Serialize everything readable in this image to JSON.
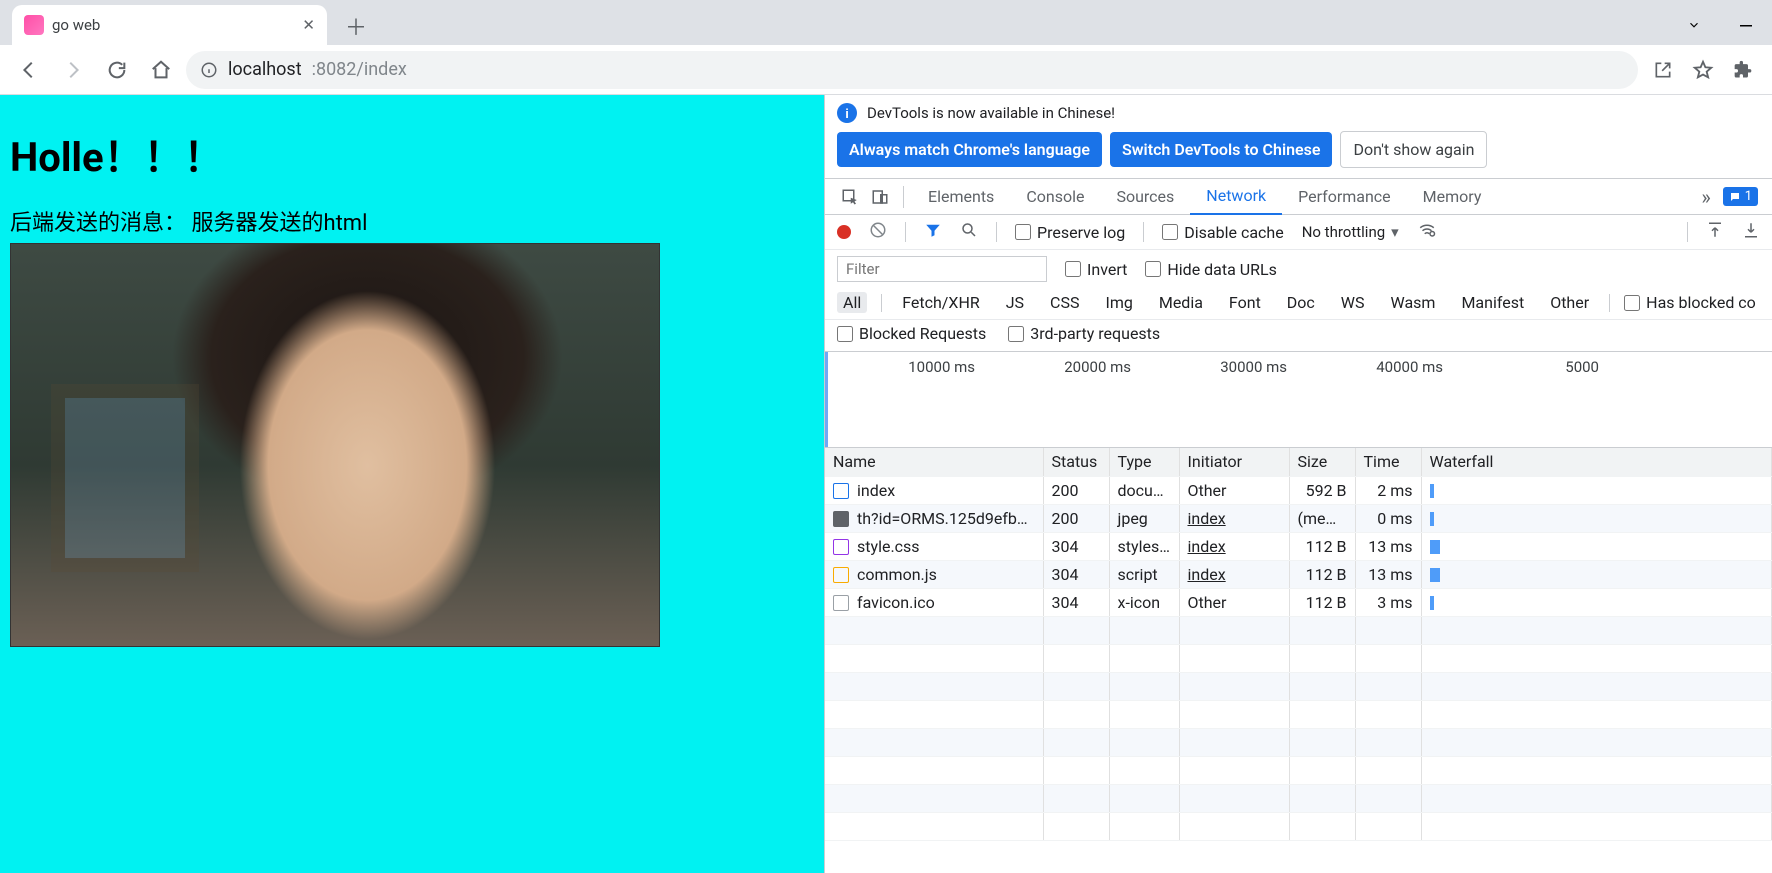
{
  "browser": {
    "tab_title": "go web",
    "url_host": "localhost",
    "url_rest": ":8082/index"
  },
  "page": {
    "heading": "Holle！！！",
    "message": "后端发送的消息： 服务器发送的html"
  },
  "devtools": {
    "infobar_text": "DevTools is now available in Chinese!",
    "btn_match": "Always match Chrome's language",
    "btn_switch": "Switch DevTools to Chinese",
    "btn_dont": "Don't show again",
    "tabs": [
      "Elements",
      "Console",
      "Sources",
      "Network",
      "Performance",
      "Memory"
    ],
    "active_tab": "Network",
    "console_count": "1",
    "net_toolbar": {
      "preserve_log": "Preserve log",
      "disable_cache": "Disable cache",
      "throttling": "No throttling"
    },
    "filter_placeholder": "Filter",
    "invert": "Invert",
    "hide_urls": "Hide data URLs",
    "type_filters": [
      "All",
      "Fetch/XHR",
      "JS",
      "CSS",
      "Img",
      "Media",
      "Font",
      "Doc",
      "WS",
      "Wasm",
      "Manifest",
      "Other"
    ],
    "has_blocked": "Has blocked co",
    "blocked_req": "Blocked Requests",
    "third_party": "3rd-party requests",
    "timeline_ticks": [
      "10000 ms",
      "20000 ms",
      "30000 ms",
      "40000 ms",
      "5000"
    ],
    "columns": [
      "Name",
      "Status",
      "Type",
      "Initiator",
      "Size",
      "Time",
      "Waterfall"
    ],
    "rows": [
      {
        "icon": "doc",
        "name": "index",
        "status": "200",
        "type": "docu…",
        "initiator": "Other",
        "init_link": false,
        "size": "592 B",
        "time": "2 ms",
        "wf": "1"
      },
      {
        "icon": "img",
        "name": "th?id=ORMS.125d9efb1…",
        "status": "200",
        "type": "jpeg",
        "initiator": "index",
        "init_link": true,
        "size": "(mem…",
        "time": "0 ms",
        "wf": "1"
      },
      {
        "icon": "css",
        "name": "style.css",
        "status": "304",
        "type": "styles…",
        "initiator": "index",
        "init_link": true,
        "size": "112 B",
        "time": "13 ms",
        "wf": "2"
      },
      {
        "icon": "js",
        "name": "common.js",
        "status": "304",
        "type": "script",
        "initiator": "index",
        "init_link": true,
        "size": "112 B",
        "time": "13 ms",
        "wf": "2"
      },
      {
        "icon": "oth",
        "name": "favicon.ico",
        "status": "304",
        "type": "x-icon",
        "initiator": "Other",
        "init_link": false,
        "size": "112 B",
        "time": "3 ms",
        "wf": "1"
      }
    ]
  }
}
